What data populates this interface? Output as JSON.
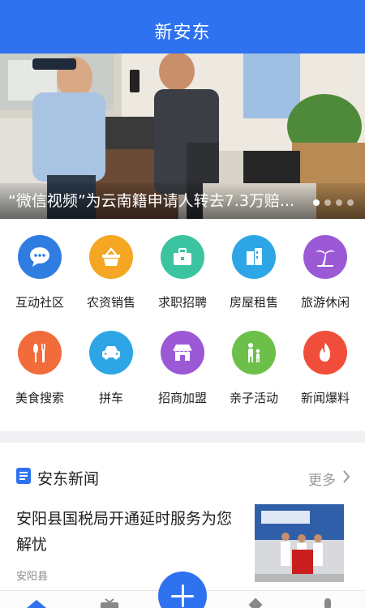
{
  "header": {
    "title": "新安东"
  },
  "banner": {
    "caption": "“微信视频”为云南籍申请人转去7.3万赔...",
    "slide_count": 4,
    "active_slide": 1
  },
  "services": [
    {
      "label": "互动社区",
      "icon": "chat-bubble-icon",
      "color": "#2f7de1"
    },
    {
      "label": "农资销售",
      "icon": "basket-icon",
      "color": "#f5a623"
    },
    {
      "label": "求职招聘",
      "icon": "briefcase-icon",
      "color": "#3cc4a1"
    },
    {
      "label": "房屋租售",
      "icon": "building-icon",
      "color": "#2ea6e6"
    },
    {
      "label": "旅游休闲",
      "icon": "palm-tree-icon",
      "color": "#9b59d6"
    },
    {
      "label": "美食搜索",
      "icon": "cutlery-icon",
      "color": "#f26b3a"
    },
    {
      "label": "拼车",
      "icon": "car-icon",
      "color": "#2ea6e6"
    },
    {
      "label": "招商加盟",
      "icon": "storefront-icon",
      "color": "#9b59d6"
    },
    {
      "label": "亲子活动",
      "icon": "parent-child-icon",
      "color": "#6cc04a"
    },
    {
      "label": "新闻爆料",
      "icon": "flame-icon",
      "color": "#f04e3a"
    }
  ],
  "news_section": {
    "title": "安东新闻",
    "more_label": "更多",
    "items": [
      {
        "headline": "安阳县国税局开通延时服务为您解忧",
        "source": "安阳县"
      }
    ]
  },
  "bottom_nav": {
    "icons": [
      "home-icon",
      "tv-icon",
      "plus-icon",
      "shapes-icon",
      "mic-icon"
    ],
    "accent": "#2f72f0"
  }
}
